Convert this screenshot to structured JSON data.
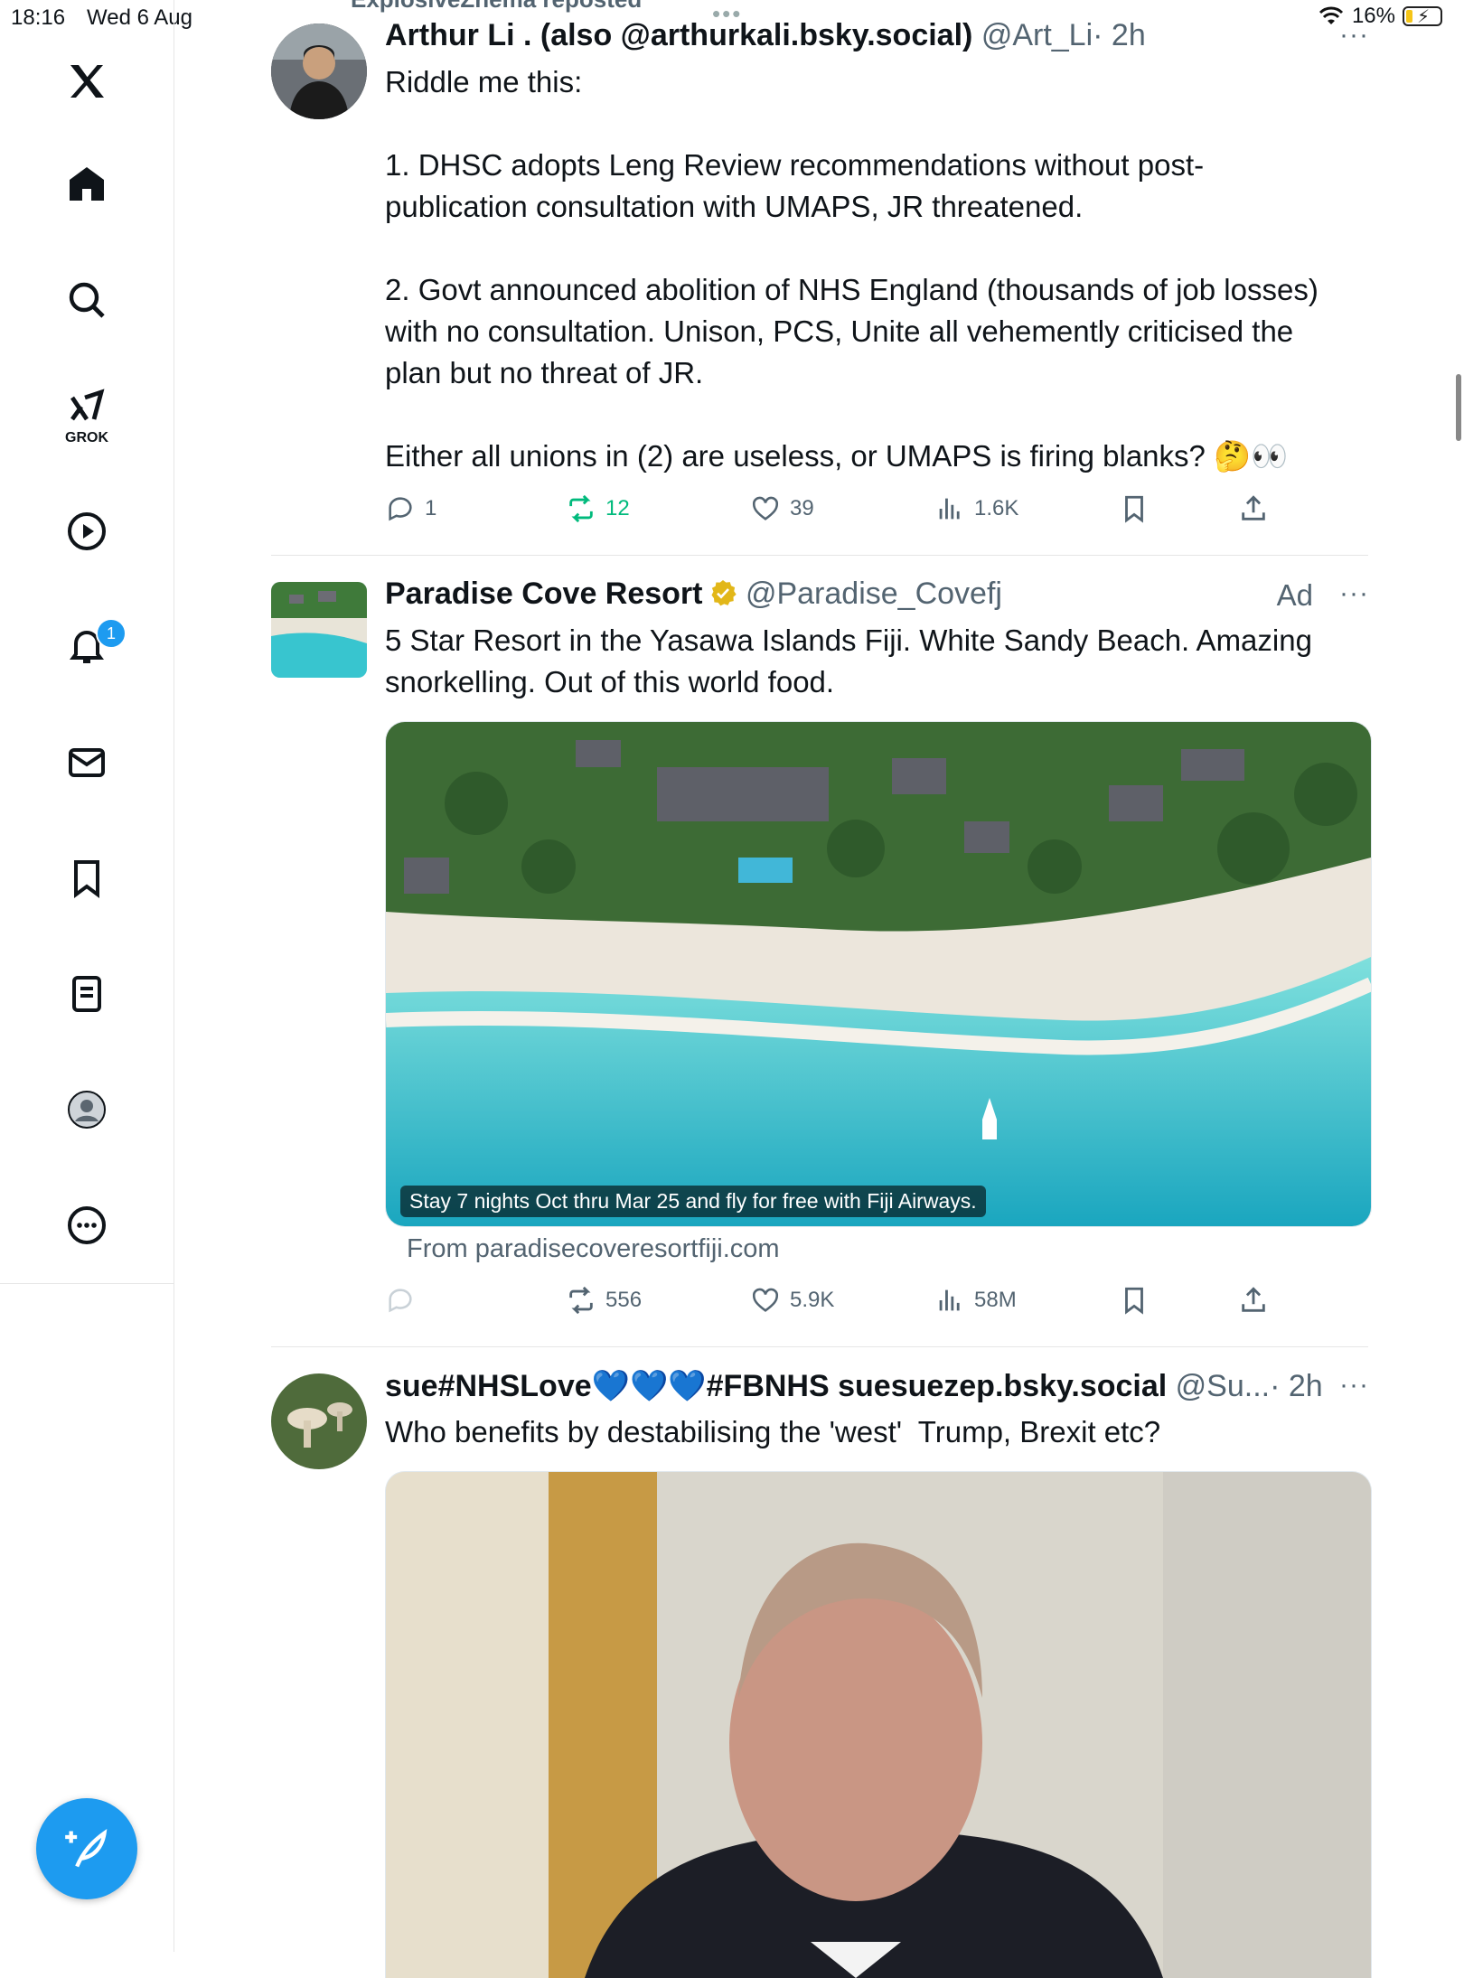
{
  "status_bar": {
    "time": "18:16",
    "date": "Wed 6 Aug",
    "battery": "16%",
    "multitask": "•••"
  },
  "sidebar": {
    "items": [
      {
        "label": "X"
      },
      {
        "label": "Home"
      },
      {
        "label": "Search"
      },
      {
        "label": "GROK"
      },
      {
        "label": "Videos"
      },
      {
        "label": "Notifications"
      },
      {
        "label": "Messages"
      },
      {
        "label": "Bookmarks"
      },
      {
        "label": "Lists"
      },
      {
        "label": "Profile"
      },
      {
        "label": "More"
      }
    ],
    "grok_label": "GROK",
    "notification_count": "1"
  },
  "tweets": [
    {
      "repost_by": "ExplosiveZhema reposted",
      "name": "Arthur Li . (also @arthurkali.bsky.social)",
      "handle": "@Art_Li",
      "time": "· 2h",
      "body": "Riddle me this:\n\n1. DHSC adopts Leng Review recommendations without post-\npublication consultation with UMAPS, JR threatened.\n\n2. Govt announced abolition of NHS England (thousands of job losses)\nwith no consultation. Unison, PCS, Unite all vehemently criticised the\nplan but no threat of JR.\n\nEither all unions in (2) are useless, or UMAPS is firing blanks? 🤔👀",
      "replies": "1",
      "reposts": "12",
      "likes": "39",
      "views": "1.6K"
    },
    {
      "name": "Paradise Cove Resort",
      "handle": "@Paradise_Covefj",
      "ad_label": "Ad",
      "body": "5 Star Resort in the Yasawa Islands Fiji. White Sandy Beach. Amazing\nsnorkelling. Out of this world food.",
      "media_caption": "Stay 7 nights Oct thru Mar 25 and fly for free with Fiji Airways.",
      "from": "From paradisecoveresortfiji.com",
      "replies": "",
      "reposts": "556",
      "likes": "5.9K",
      "views": "58M"
    },
    {
      "name": "sue#NHSLove💙💙💙#FBNHS suesuezep.bsky.social",
      "handle": "@Su...",
      "time": "· 2h",
      "body": "Who benefits by destabilising the 'west'  Trump, Brexit etc?"
    }
  ],
  "colors": {
    "accent": "#1d9bf0",
    "repost_green": "#00ba7c",
    "muted": "#536471",
    "verified_gold": "#e2b719"
  },
  "more_glyph": "···"
}
